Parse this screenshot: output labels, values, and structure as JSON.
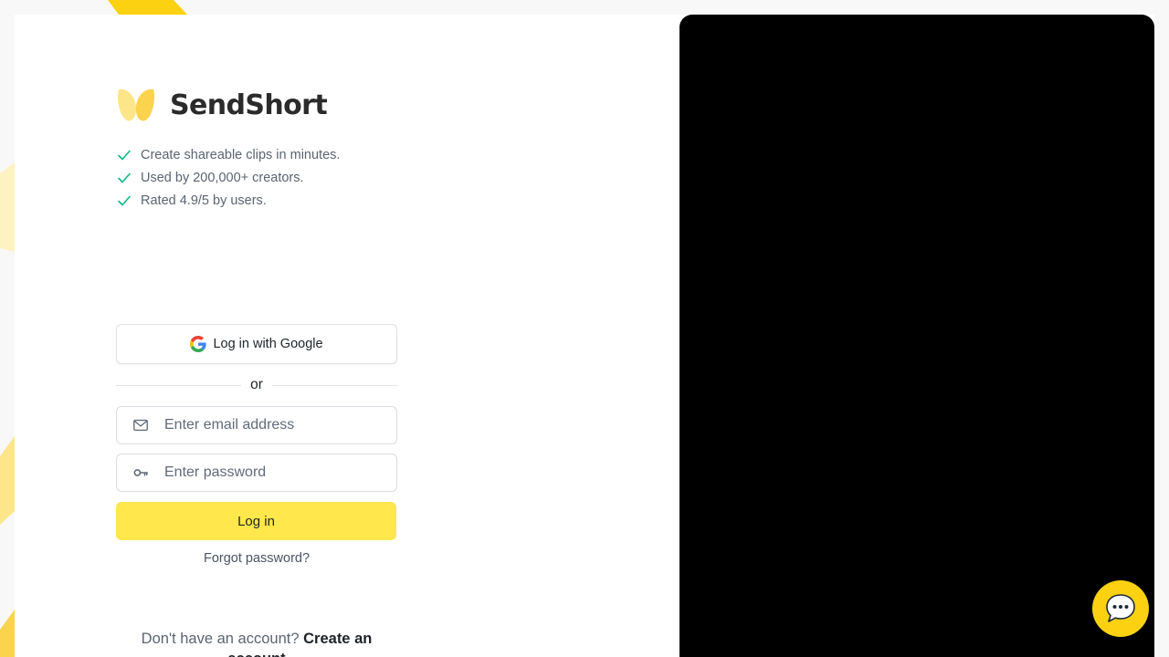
{
  "brand": {
    "name": "SendShort",
    "colors": {
      "primary": "#ffe74c",
      "logo": "#fcd34d",
      "check": "#10b981",
      "chat": "#fcd111"
    }
  },
  "features": [
    {
      "text": "Create shareable clips in minutes.",
      "icon": "check-icon"
    },
    {
      "text": "Used by 200,000+ creators.",
      "icon": "check-icon"
    },
    {
      "text": "Rated 4.9/5 by users.",
      "icon": "check-icon"
    }
  ],
  "auth": {
    "google_label": "Log in with Google",
    "divider": "or",
    "email_placeholder": "Enter email address",
    "password_placeholder": "Enter password",
    "login_label": "Log in",
    "forgot_label": "Forgot password?",
    "signup_prompt": "Don't have an account?",
    "signup_link": "Create an account"
  },
  "chat": {
    "icon": "chat-bubble-icon"
  }
}
